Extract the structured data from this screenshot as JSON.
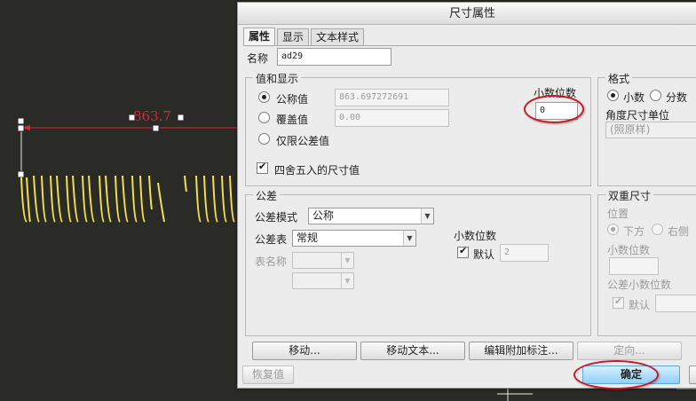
{
  "canvas": {
    "dimension_value": "863.7"
  },
  "dialog": {
    "title": "尺寸属性",
    "tabs": [
      "属性",
      "显示",
      "文本样式"
    ],
    "name_label": "名称",
    "name_value": "ad29",
    "value_display": {
      "title": "值和显示",
      "nominal_label": "公称值",
      "nominal_value": "863.697272691",
      "override_label": "覆盖值",
      "override_value": "0.00",
      "tolerance_only_label": "仅限公差值",
      "decimal_label": "小数位数",
      "decimal_value": "0",
      "rounded_label": "四舍五入的尺寸值"
    },
    "format": {
      "title": "格式",
      "decimal_option": "小数",
      "fraction_option": "分数",
      "angle_unit_label": "角度尺寸单位",
      "angle_unit_value": "(照原样)"
    },
    "tolerance": {
      "title": "公差",
      "mode_label": "公差模式",
      "mode_value": "公称",
      "table_label": "公差表",
      "table_value": "常规",
      "table_name_label": "表名称",
      "decimal_label": "小数位数",
      "default_label": "默认",
      "decimal_value": "2"
    },
    "dual": {
      "title": "双重尺寸",
      "position_label": "位置",
      "below_option": "下方",
      "right_option": "右侧",
      "decimal_label": "小数位数",
      "tol_decimal_label": "公差小数位数",
      "default_label": "默认"
    },
    "buttons": {
      "move": "移动...",
      "move_text": "移动文本...",
      "edit_attached": "编辑附加标注...",
      "orient": "定向...",
      "restore": "恢复值",
      "ok": "确定"
    }
  }
}
